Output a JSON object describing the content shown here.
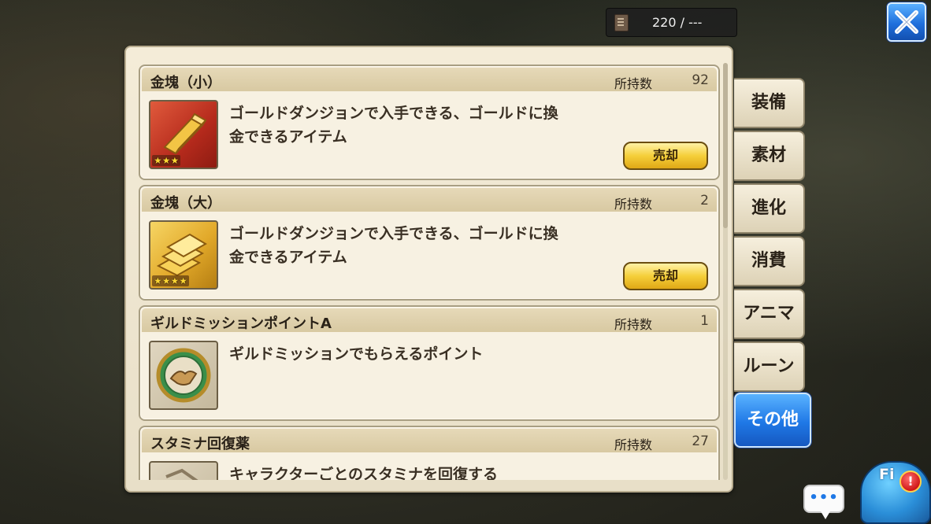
{
  "header": {
    "counter_icon": "bag-icon",
    "counter_text": "220 / ---",
    "close_icon": "close-icon"
  },
  "items": [
    {
      "name": "金塊（小）",
      "own_label": "所持数",
      "count": "92",
      "stars": "★★★",
      "icon": "gold-bar-small-icon",
      "description": "ゴールドダンジョンで入手できる、ゴールドに換金できるアイテム",
      "desc_line1": "ゴールドダンジョンで入手できる、ゴールドに換",
      "desc_line2": "金できるアイテム",
      "sell_label": "売却"
    },
    {
      "name": "金塊（大）",
      "own_label": "所持数",
      "count": "2",
      "stars": "★★★★",
      "icon": "gold-bars-large-icon",
      "desc_line1": "ゴールドダンジョンで入手できる、ゴールドに換",
      "desc_line2": "金できるアイテム",
      "sell_label": "売却"
    },
    {
      "name": "ギルドミッションポイントA",
      "own_label": "所持数",
      "count": "1",
      "icon": "guild-handshake-medal-icon",
      "desc_line1": "ギルドミッションでもらえるポイント",
      "desc_line2": ""
    },
    {
      "name": "スタミナ回復薬",
      "own_label": "所持数",
      "count": "27",
      "icon": "stamina-potion-icon",
      "desc_line1": "キャラクターごとのスタミナを回復する",
      "desc_line2": ""
    }
  ],
  "tabs": [
    {
      "label": "装備",
      "active": false
    },
    {
      "label": "素材",
      "active": false
    },
    {
      "label": "進化",
      "active": false
    },
    {
      "label": "消費",
      "active": false
    },
    {
      "label": "アニマ",
      "active": false
    },
    {
      "label": "ルーン",
      "active": false
    },
    {
      "label": "その他",
      "active": true
    }
  ],
  "chat": {
    "label": "•••",
    "icon": "chat-bubble-icon"
  },
  "mascot": {
    "label": "Fi",
    "alert": "!",
    "icon": "mascot-character-icon"
  },
  "colors": {
    "active_tab": "#1f78e6",
    "sell_button": "#f5cf3a",
    "panel": "#f4ecd8"
  }
}
